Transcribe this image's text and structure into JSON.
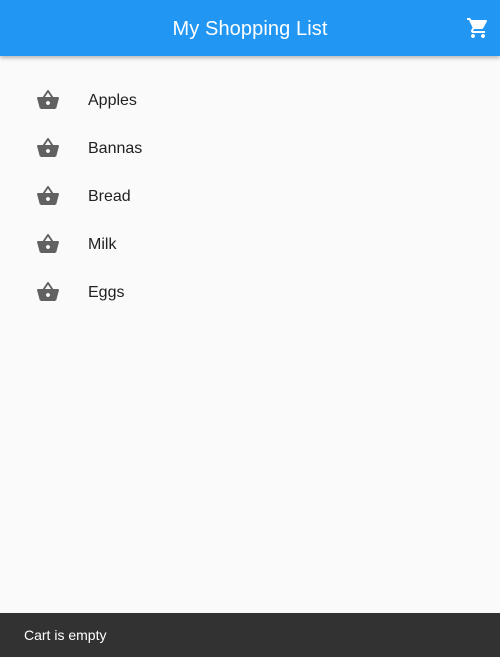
{
  "app_bar": {
    "title": "My Shopping List",
    "background_color": "#2196f3",
    "cart_icon": "shopping-cart-icon"
  },
  "list": {
    "item_icon": "shopping-basket-icon",
    "icon_color": "#616161",
    "items": [
      {
        "label": "Apples"
      },
      {
        "label": "Bannas"
      },
      {
        "label": "Bread"
      },
      {
        "label": "Milk"
      },
      {
        "label": "Eggs"
      }
    ]
  },
  "snackbar": {
    "message": "Cart is empty",
    "background_color": "#323232"
  }
}
